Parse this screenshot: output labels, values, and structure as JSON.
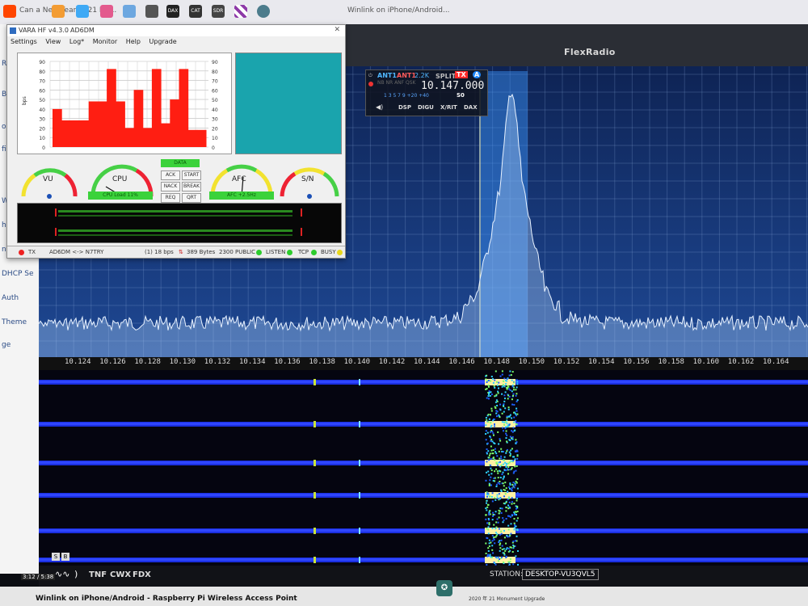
{
  "os_tabs": {
    "items": [
      {
        "label": "Reddit",
        "color": "#ff4500"
      },
      {
        "label": "VARA",
        "color": "#e7704a"
      },
      {
        "label": "",
        "color": "#3fa9f5"
      },
      {
        "label": "DAX",
        "color": "#222222"
      },
      {
        "label": "CAT",
        "color": "#333333"
      },
      {
        "label": "SDR",
        "color": "#444444"
      }
    ]
  },
  "browser_tabs": [
    "Can a New Year 2021 Hit...",
    "Winlink on iPhone/Android..."
  ],
  "left_sidebar": {
    "items": [
      "Ri",
      "Bl",
      "oog",
      "fi",
      "Wi",
      "hot",
      "net",
      "DHCP Se",
      "Auth",
      "Theme",
      "ge"
    ]
  },
  "flex": {
    "logo": "FlexRadio",
    "slice": {
      "ant1": "ANT1",
      "ant2": "ANT1",
      "bw": "2.2K",
      "split": "SPLIT",
      "tx": "TX",
      "slice_letter": "A",
      "modes": "NB NR ANF QSK",
      "frequency": "10.147.000",
      "smeter_scale": "1  3  5  7  9 +20 +40",
      "smeter_value": "S0",
      "buttons": [
        "DSP",
        "DIGU",
        "X/RIT",
        "DAX"
      ]
    },
    "freq_ticks": [
      "10.124",
      "10.126",
      "10.128",
      "10.130",
      "10.132",
      "10.134",
      "10.136",
      "10.138",
      "10.140",
      "10.142",
      "10.144",
      "10.146",
      "10.148",
      "10.150",
      "10.152",
      "10.154",
      "10.156",
      "10.158",
      "10.160",
      "10.162",
      "10.164"
    ],
    "bottom_bar": {
      "tools": [
        "TNF",
        "CWX",
        "FDX"
      ],
      "station_label": "STATION:",
      "station_name": "DESKTOP-VU3QVL5"
    },
    "colors": {
      "accent": "#1aa3ff",
      "tx_red": "#ff2a2a",
      "pan_bg": "#1a3f86"
    }
  },
  "vara": {
    "title": "VARA HF v4.3.0",
    "callsign": "AD6DM",
    "menu": [
      "Settings",
      "View",
      "Log*",
      "Monitor",
      "Help",
      "Upgrade"
    ],
    "chart_ylabel": "bps",
    "chart_yticks": [
      "90",
      "80",
      "70",
      "60",
      "50",
      "40",
      "30",
      "20",
      "10",
      "0"
    ],
    "chart_yticks_right": [
      "90",
      "80",
      "70",
      "60",
      "50",
      "40",
      "30",
      "20",
      "10",
      "0"
    ],
    "bars": [
      40,
      28,
      28,
      28,
      48,
      48,
      82,
      48,
      20,
      60,
      20,
      82,
      25,
      50,
      82,
      18,
      18
    ],
    "gauges": {
      "vu": "VU",
      "cpu": "CPU",
      "afc": "AFC",
      "sn": "S/N",
      "cpu_readout": "CPU Load 11%",
      "afc_readout": "AFC +2.5Hz"
    },
    "buttons": {
      "data": "DATA",
      "ack": "ACK",
      "start": "START",
      "nack": "NACK",
      "break": "BREAK",
      "req": "REQ",
      "qrt": "QRT"
    },
    "status": {
      "tx": "TX",
      "link": "AD6DM <-> N7TRY",
      "speed": "(1) 18 bps",
      "bytes": "389 Bytes",
      "bw": "2300",
      "public": "PUBLIC",
      "listen": "LISTEN",
      "tcp": "TCP",
      "busy": "BUSY"
    }
  },
  "os_bottom": {
    "time": "3:12 / 5:38",
    "video_title": "Winlink on iPhone/Android - Raspberry Pi Wireless Access Point",
    "date_text": "2020 年 21 Monument Upgrade"
  }
}
